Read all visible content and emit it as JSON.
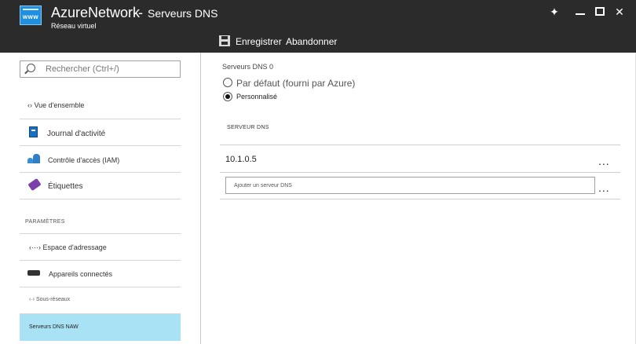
{
  "window": {
    "title": "AzureNetwork",
    "separator": "-",
    "blade_title": "Serveurs DNS",
    "subtitle": "Réseau virtuel",
    "logo_text": "www",
    "controls": {
      "pin_icon": "pin-icon",
      "minimize_icon": "minimize-icon",
      "maximize_icon": "maximize-icon",
      "close_icon": "close-icon",
      "close_glyph": "✕",
      "pin_glyph": "✦"
    }
  },
  "toolbar": {
    "save_label": "Enregistrer",
    "discard_label": "Abandonner",
    "save_icon": "save-icon"
  },
  "sidebar": {
    "search_placeholder": "Rechercher (Ctrl+/)",
    "items": [
      {
        "label": "‹› Vue d'ensemble",
        "icon": "overview-icon"
      },
      {
        "label": "Journal d'activité",
        "icon": "activity-log-icon"
      },
      {
        "label": "Contrôle d'accès (IAM)",
        "icon": "access-control-icon"
      },
      {
        "label": "Étiquettes",
        "icon": "tag-icon"
      }
    ],
    "section_header": "PARAMÈTRES",
    "settings_items": [
      {
        "label": "‹···› Espace d'adressage",
        "icon": "address-space-icon"
      },
      {
        "label": "Appareils connectés",
        "icon": "connected-devices-icon"
      },
      {
        "label": "‹·› Sous-réseaux",
        "icon": "subnets-icon"
      },
      {
        "label": "Serveurs DNS NAW",
        "icon": "dns-servers-icon",
        "selected": true
      }
    ]
  },
  "main": {
    "section_title": "Serveurs DNS 0",
    "options": [
      {
        "label": "Par défaut (fourni par Azure)",
        "selected": false
      },
      {
        "label": "Personnalisé",
        "selected": true
      }
    ],
    "column_header": "SERVEUR DNS",
    "dns_servers": [
      "10.1.0.5"
    ],
    "add_placeholder": "Ajouter un serveur DNS",
    "more_label": "..."
  }
}
